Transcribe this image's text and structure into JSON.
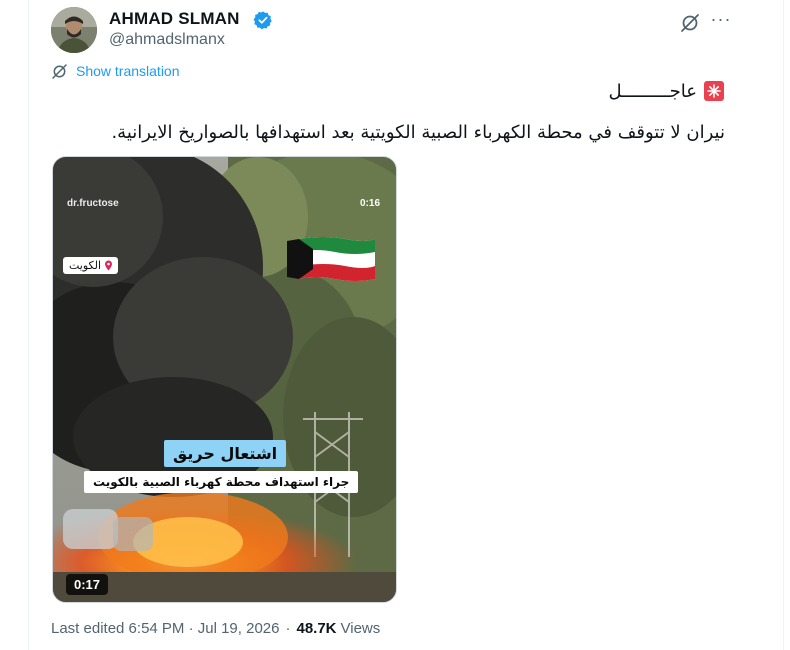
{
  "author": {
    "display_name": "AHMAD SLMAN",
    "handle": "@ahmadslmanx",
    "verified_icon": "verified-badge-icon",
    "verified_color": "#1d9bf0"
  },
  "actions": {
    "grok_icon": "grok-icon",
    "more_icon": "more-options-icon",
    "more_glyph": "···"
  },
  "translation": {
    "icon": "translate-icon",
    "label": "Show translation"
  },
  "tweet": {
    "line_1": "عاجـــــــــل",
    "line_2": "نيران لا تتوقف في محطة الكهرباء الصبية الكويتية بعد استهدافها بالصواريخ الايرانية."
  },
  "media": {
    "watermark": "dr.fructose",
    "timer_top": "0:16",
    "location_tag": "الكويت",
    "flag_icon": "kuwait-flag-icon",
    "caption_1": "اشتعال حريق",
    "caption_2": "جراء استهداف محطة كهرباء الصبية بالكويت",
    "duration": "0:17"
  },
  "meta": {
    "edited": "Last edited 6:54 PM · Jul 19, 2026",
    "separator": "·",
    "views_count": "48.7K",
    "views_label": "Views"
  },
  "colors": {
    "accent": "#1d9bf0",
    "text_primary": "#0f1419",
    "text_secondary": "#536471",
    "caption_highlight": "#8ed3f5"
  }
}
